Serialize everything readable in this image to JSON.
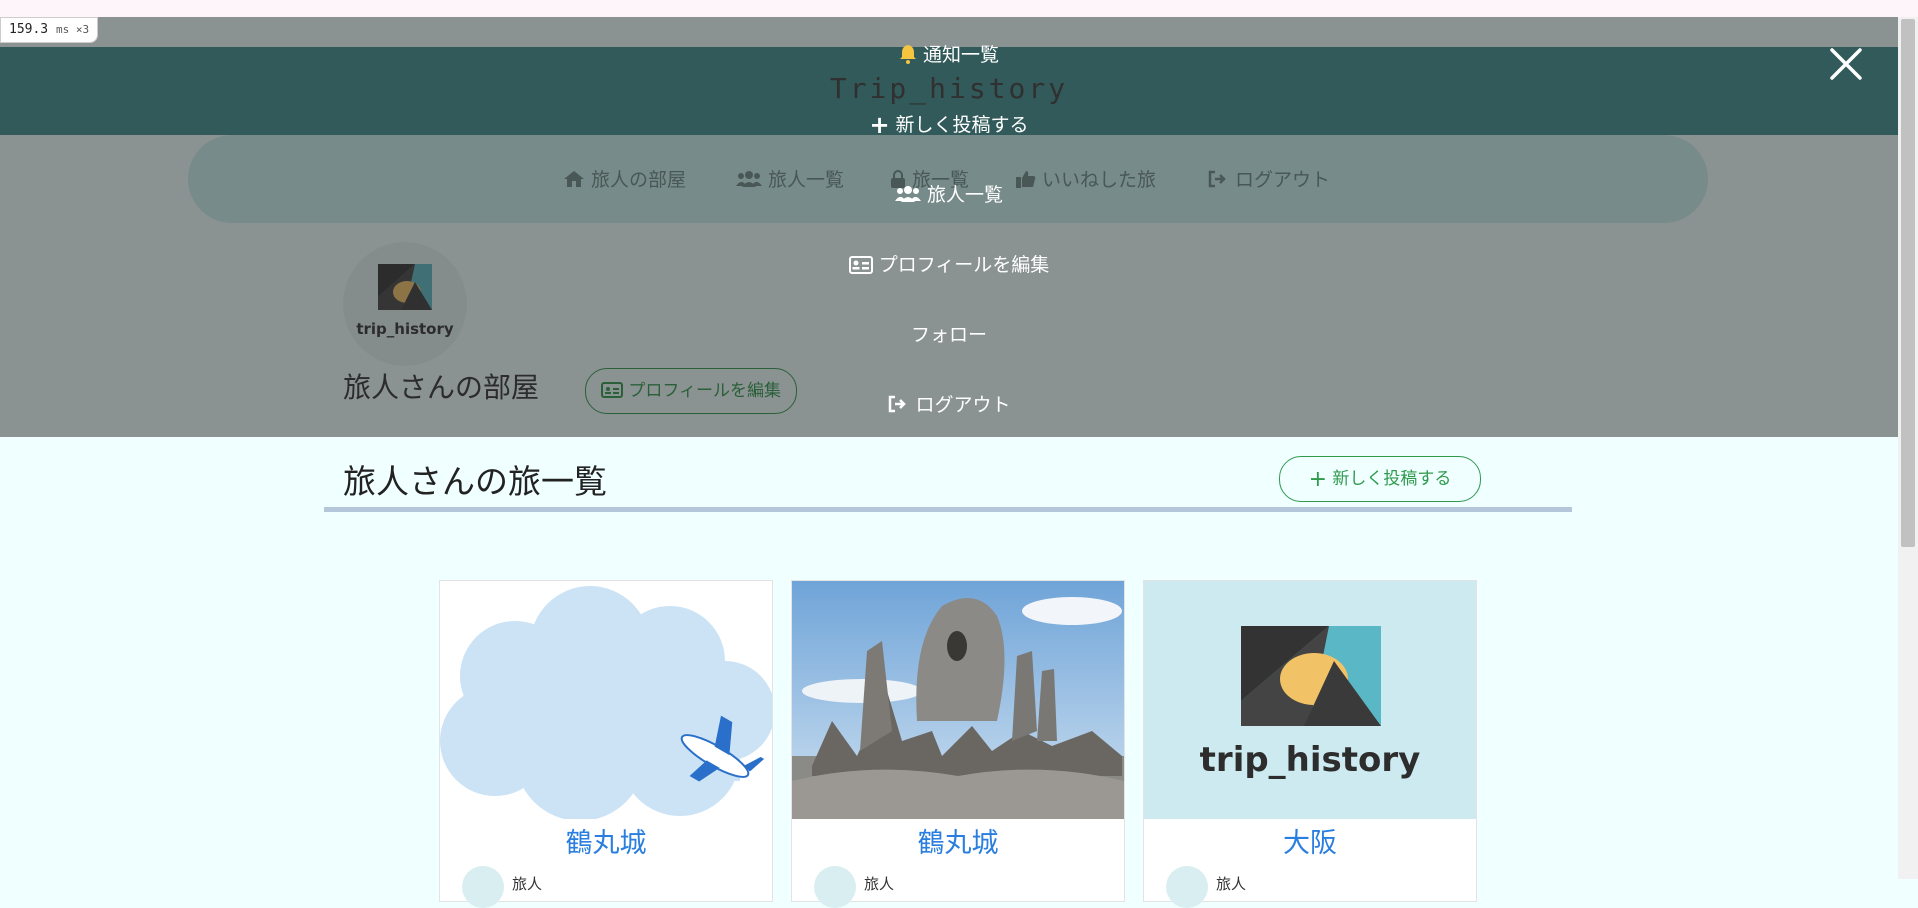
{
  "perf": {
    "value": "159.3",
    "unit": "ms ×3"
  },
  "header": {
    "brand": "Trip_history"
  },
  "subnav": {
    "items": [
      {
        "label": "旅人の部屋",
        "icon": "home-icon"
      },
      {
        "label": "旅人一覧",
        "icon": "users-icon"
      },
      {
        "label": "旅一覧",
        "icon": "lock-icon"
      },
      {
        "label": "いいねした旅",
        "icon": "thumbs-up-icon"
      },
      {
        "label": "ログアウト",
        "icon": "sign-out-icon"
      }
    ]
  },
  "profile": {
    "avatar_text": "trip_history",
    "title": "旅人さんの部屋",
    "edit_label": "プロフィールを編集"
  },
  "list": {
    "title": "旅人さんの旅一覧",
    "new_label": "新しく投稿する"
  },
  "cards": [
    {
      "title": "鶴丸城",
      "author": "旅人",
      "image": "cloud-airplane-image"
    },
    {
      "title": "鶴丸城",
      "author": "旅人",
      "image": "stone-monument-photo"
    },
    {
      "title": "大阪",
      "author": "旅人",
      "image": "trip-history-logo"
    }
  ],
  "logo": {
    "text": "trip_history"
  },
  "overlay_menu": {
    "items": [
      {
        "label": "通知一覧",
        "icon": "bell-icon"
      },
      {
        "label": "新しく投稿する",
        "icon": "plus-icon"
      },
      {
        "label": "旅人一覧",
        "icon": "users-icon"
      },
      {
        "label": "プロフィールを編集",
        "icon": "id-card-icon"
      },
      {
        "label": "フォロー",
        "icon": ""
      },
      {
        "label": "ログアウト",
        "icon": "sign-out-icon"
      }
    ]
  },
  "colors": {
    "header": "#3f8f8f",
    "accent_green": "#2f9a4c",
    "link_blue": "#2a7ee0",
    "page_bg": "#f0ffff",
    "bell": "#f5c542"
  }
}
